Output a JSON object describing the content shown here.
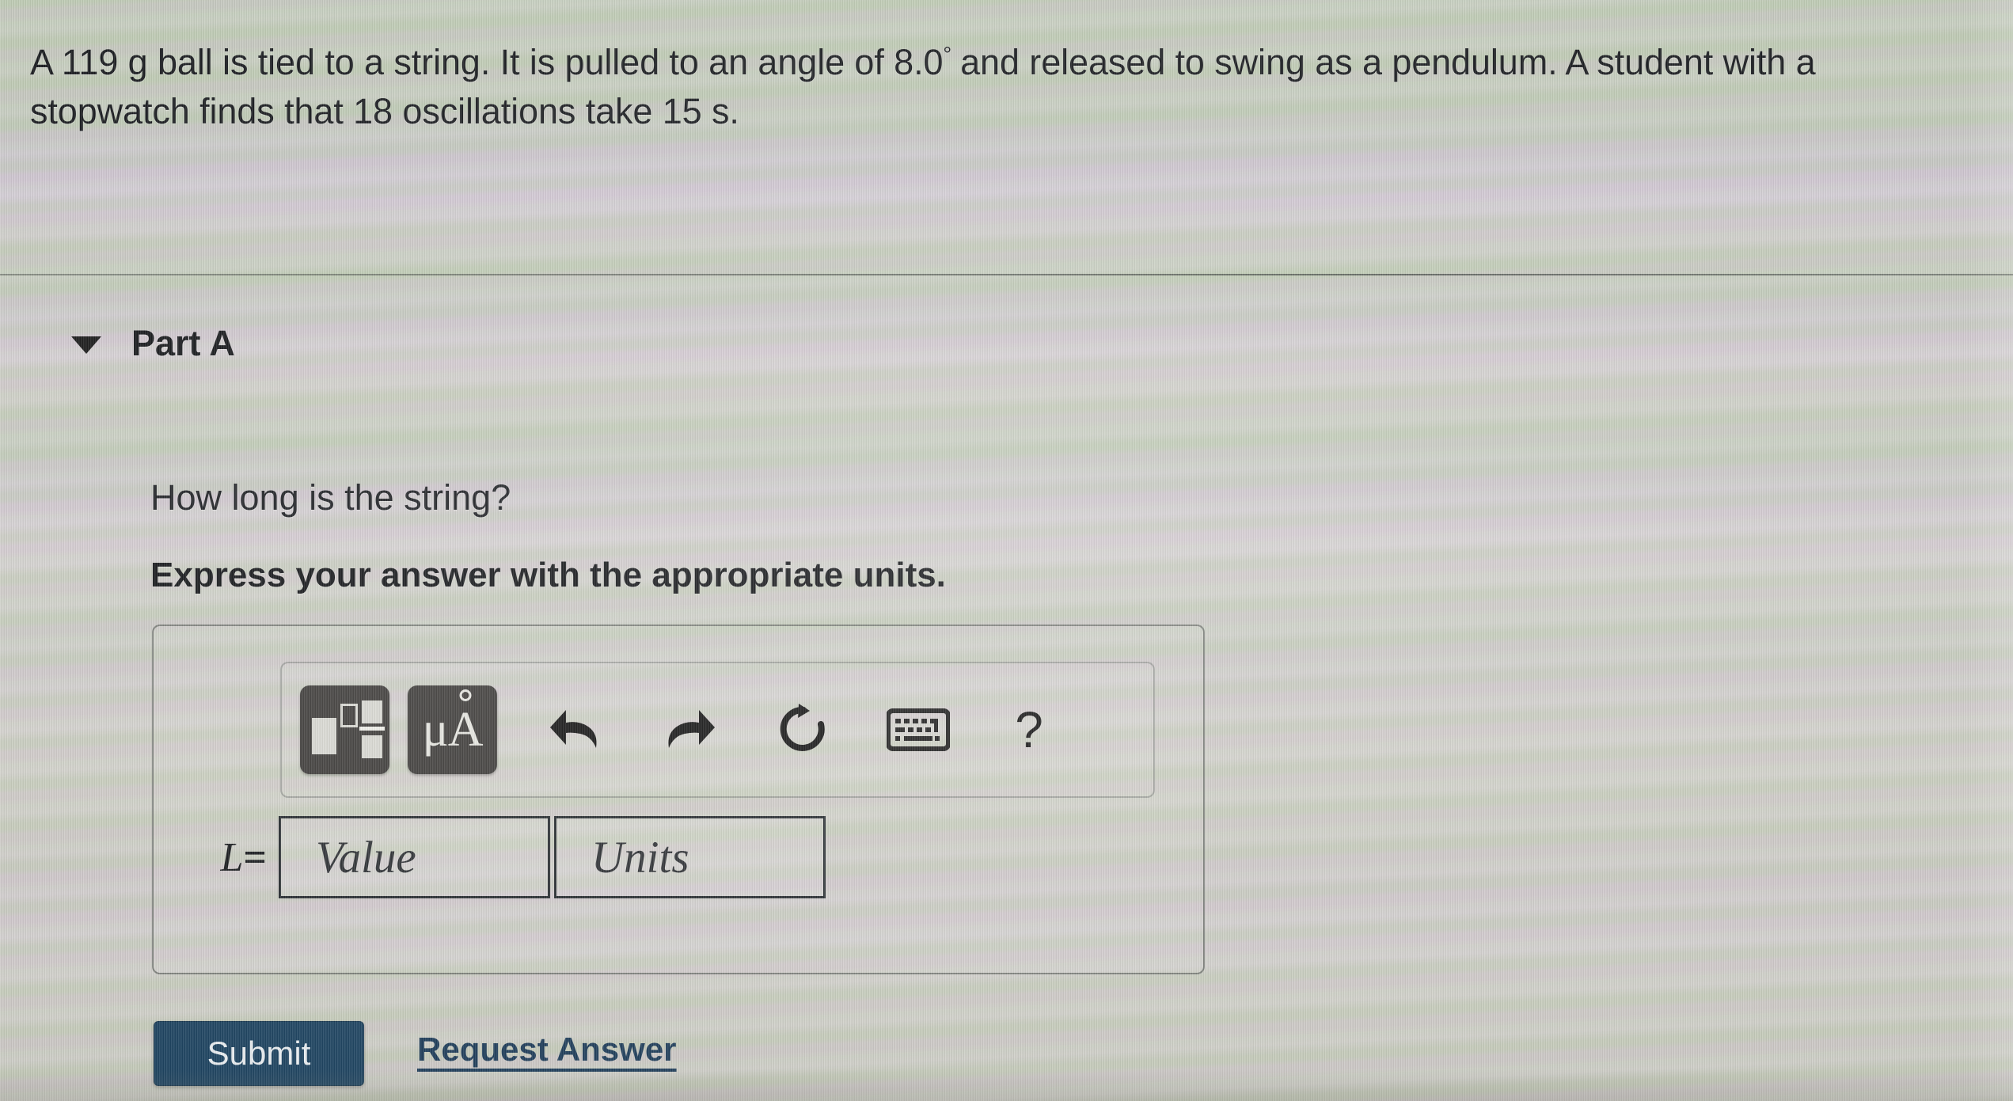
{
  "problem": {
    "line1_a": "A 119 g ball is tied to a string. It is pulled to an angle of 8.0",
    "degree": "°",
    "line1_b": "and released to swing as a pendulum. A student with a",
    "line2": "stopwatch finds that 18 oscillations take 15 s."
  },
  "part": {
    "caret_icon": "chevron-down-icon",
    "title": "Part A"
  },
  "question": {
    "prompt": "How long is the string?",
    "instruction": "Express your answer with the appropriate units."
  },
  "toolbar": {
    "math_template_label": "math-template",
    "units_label": "μA",
    "units_mu": "μ",
    "units_a": "A",
    "undo_label": "undo",
    "redo_label": "redo",
    "reset_label": "reset",
    "keyboard_label": "keyboard",
    "help_label": "?"
  },
  "answer": {
    "lhs_symbol": "L",
    "lhs_equals": "=",
    "value_placeholder": "Value",
    "units_placeholder": "Units"
  },
  "actions": {
    "submit_label": "Submit",
    "request_answer_label": "Request Answer"
  },
  "colors": {
    "submit_bg": "#1d4360",
    "link": "#1c3b58",
    "key_bg": "#3c3a38",
    "field_border": "#23282c",
    "page_bg": "#d3d4cc"
  }
}
